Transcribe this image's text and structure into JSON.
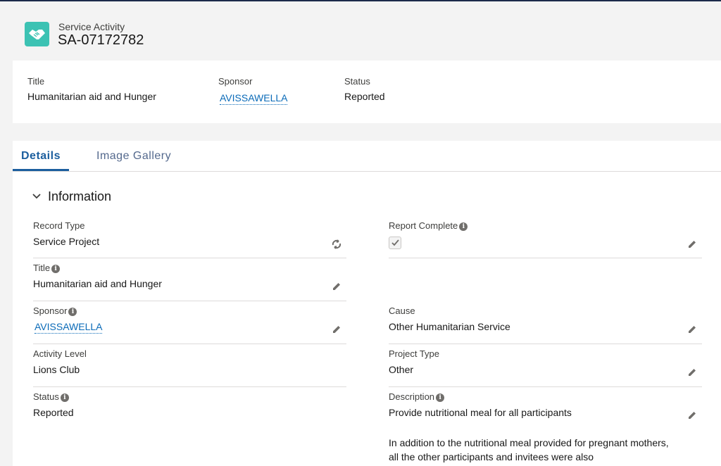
{
  "header": {
    "object_type": "Service Activity",
    "record_name": "SA-07172782"
  },
  "highlights": {
    "title_label": "Title",
    "title_value": "Humanitarian aid and Hunger",
    "sponsor_label": "Sponsor",
    "sponsor_value": "AVISSAWELLA",
    "status_label": "Status",
    "status_value": "Reported"
  },
  "tabs": [
    {
      "label": "Details",
      "active": true
    },
    {
      "label": "Image Gallery",
      "active": false
    }
  ],
  "section": {
    "title": "Information"
  },
  "fields": {
    "record_type": {
      "label": "Record Type",
      "value": "Service Project"
    },
    "report_complete": {
      "label": "Report Complete",
      "checked": true
    },
    "title": {
      "label": "Title",
      "value": "Humanitarian aid and Hunger"
    },
    "sponsor": {
      "label": "Sponsor",
      "value": "AVISSAWELLA"
    },
    "cause": {
      "label": "Cause",
      "value": "Other Humanitarian Service"
    },
    "activity_level": {
      "label": "Activity Level",
      "value": "Lions Club"
    },
    "project_type": {
      "label": "Project Type",
      "value": "Other"
    },
    "status": {
      "label": "Status",
      "value": "Reported"
    },
    "description": {
      "label": "Description",
      "value": "Provide nutritional meal for all participants",
      "continuation": "In addition to the nutritional meal provided for pregnant mothers, all the other participants and invitees were also"
    }
  },
  "icons": {
    "object": "handshake-icon",
    "info": "info-icon",
    "edit": "pencil-icon",
    "change_record_type": "swap-icon",
    "collapse": "chevron-down-icon",
    "checkbox": "checkmark-icon"
  },
  "colors": {
    "object_icon": "#3cc2b3",
    "link": "#0b6bb8",
    "active_tab": "#1b5e9e"
  }
}
